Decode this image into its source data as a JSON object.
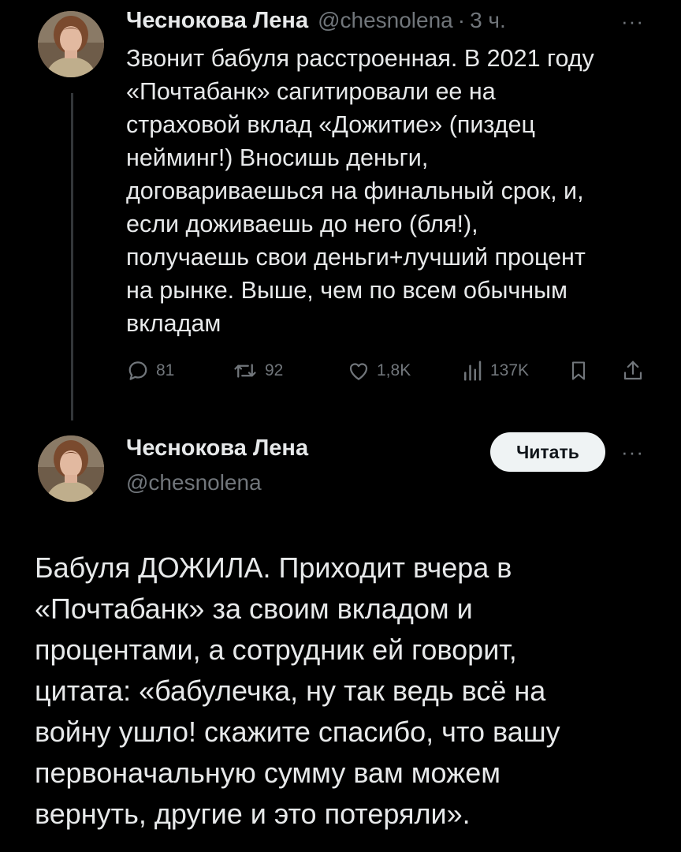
{
  "tweet1": {
    "author_name": "Чеснокова Лена",
    "handle": "@chesnolena",
    "separator": "·",
    "time": "3 ч.",
    "more": "···",
    "text": "Звонит бабуля расстроенная. В 2021 году\n«Почтабанк» сагитировали ее на\nстраховой вклад «Дожитие» (пиздец\nнейминг!) Вносишь деньги,\nдоговариваешься на финальный срок, и,\nесли доживаешь до него (бля!),\nполучаешь свои деньги+лучший процент\nна рынке. Выше, чем по всем обычным\nвкладам",
    "actions": {
      "replies": "81",
      "reposts": "92",
      "likes": "1,8K",
      "views": "137K"
    },
    "icons": [
      "reply-icon",
      "repost-icon",
      "like-icon",
      "views-icon",
      "bookmark-icon",
      "share-icon"
    ]
  },
  "tweet2": {
    "author_name": "Чеснокова Лена",
    "handle": "@chesnolena",
    "follow_label": "Читать",
    "more": "···",
    "text": "Бабуля ДОЖИЛА. Приходит вчера в\n«Почтабанк» за своим вкладом и\nпроцентами, а сотрудник ей говорит,\nцитата: «бабулечка, ну так ведь всё на\nвойну ушло! скажите спасибо, что вашу\nпервоначальную сумму вам можем\nвернуть, другие и это потеряли»."
  },
  "colors": {
    "background": "#000000",
    "text_primary": "#e7e9ea",
    "text_secondary": "#71767b",
    "thread_line": "#333639",
    "button_bg": "#eff3f4",
    "button_text": "#0f1419"
  }
}
